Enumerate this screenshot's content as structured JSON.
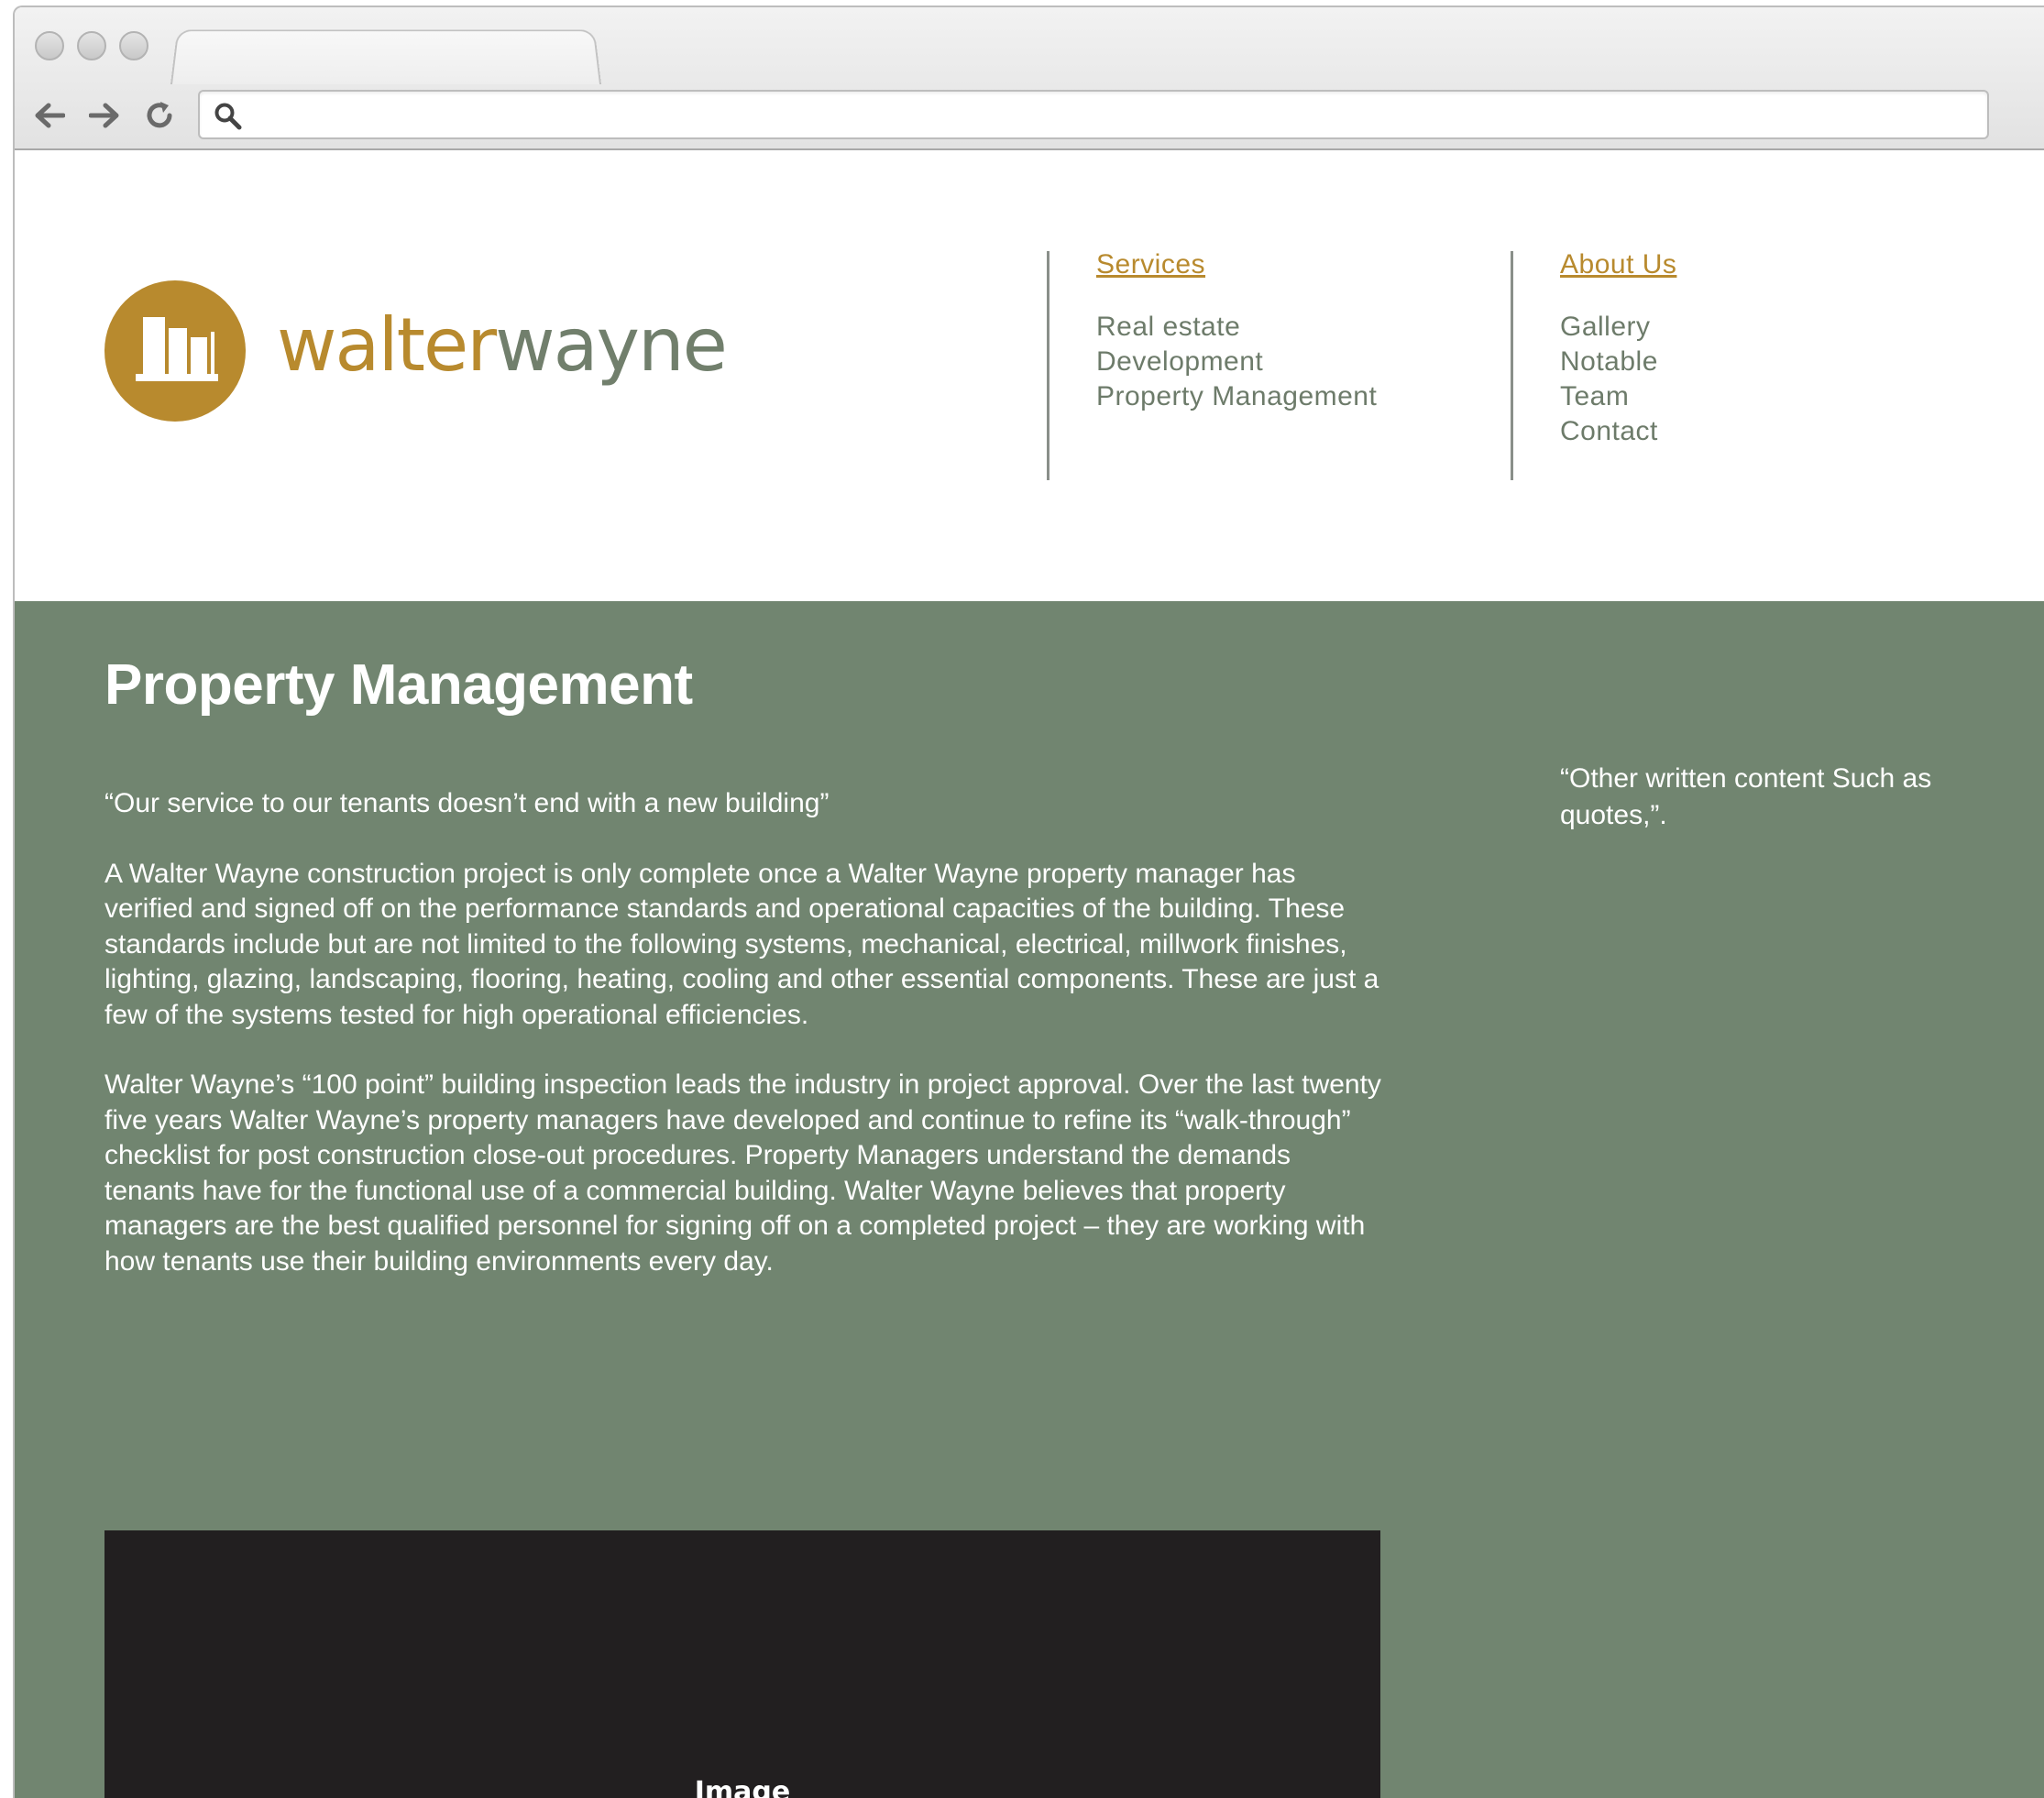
{
  "colors": {
    "brand_gold": "#b88a2e",
    "brand_green": "#717f6c",
    "nav_link": "#6d7b6a",
    "content_bg": "#718570"
  },
  "browser": {
    "address_value": "",
    "icons": {
      "back": "back-arrow-icon",
      "forward": "forward-arrow-icon",
      "reload": "reload-icon",
      "search": "search-icon"
    }
  },
  "logo": {
    "word1": "walter",
    "word2": "wayne"
  },
  "nav": {
    "services": {
      "heading": "Services",
      "links": [
        "Real estate",
        "Development",
        "Property Management"
      ]
    },
    "about": {
      "heading": "About Us",
      "links": [
        "Gallery",
        "Notable",
        "Team",
        "Contact"
      ]
    }
  },
  "content": {
    "title": "Property Management",
    "paragraphs": [
      "“Our service to our tenants doesn’t end with a new building”",
      "A Walter Wayne construction project is only complete once a Walter Wayne property manager has verified and signed off on the performance standards and operational capacities of the building.  These standards include but are not limited to the following systems, mechanical, electrical, millwork finishes, lighting, glazing, landscaping, flooring, heating, cooling and other essential components.  These are just a few of the systems tested for high operational efficiencies.",
      "Walter Wayne’s “100 point” building inspection leads the industry in project approval. Over the last twenty five years Walter Wayne’s property managers have developed and continue to refine its “walk-through” checklist for post construction close-out procedures. Property Managers understand the demands tenants have for the functional use of a commercial building. Walter Wayne believes that property managers are the best qualified personnel for signing off on a completed project – they are working with how tenants use their building environments every day."
    ],
    "side_quote": "“Other written content Such as quotes,”.",
    "image_label": "Image"
  }
}
